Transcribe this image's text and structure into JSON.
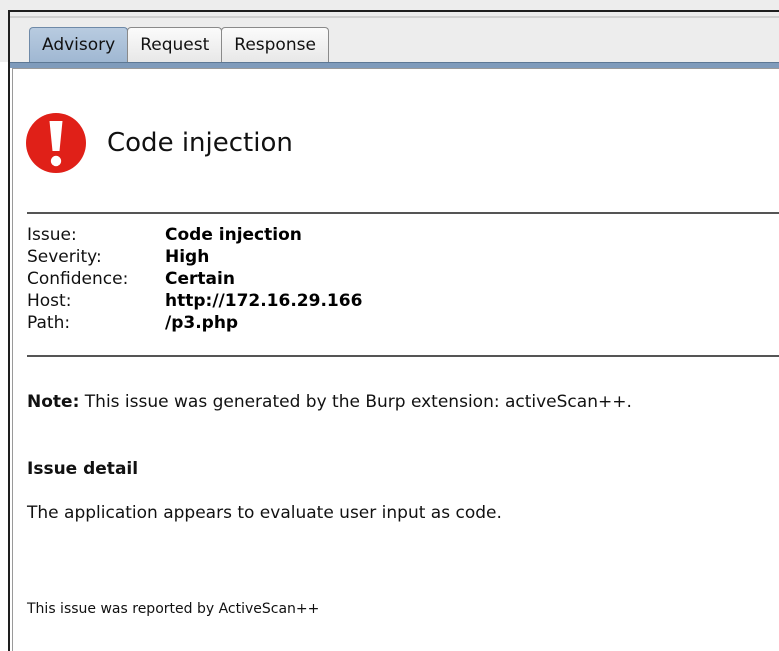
{
  "tabs": [
    {
      "label": "Advisory",
      "selected": true
    },
    {
      "label": "Request",
      "selected": false
    },
    {
      "label": "Response",
      "selected": false
    }
  ],
  "advisory": {
    "icon": "alert-exclamation-icon",
    "icon_color": "#e02018",
    "title": "Code injection",
    "fields": [
      {
        "label": "Issue:",
        "value": "Code injection"
      },
      {
        "label": "Severity:",
        "value": "High"
      },
      {
        "label": "Confidence:",
        "value": "Certain"
      },
      {
        "label": "Host:",
        "value": "http://172.16.29.166"
      },
      {
        "label": "Path:",
        "value": "/p3.php"
      }
    ],
    "note_label": "Note:",
    "note_text": " This issue was generated by the Burp extension: activeScan++.",
    "detail_heading": "Issue detail",
    "detail_text": "The application appears to evaluate user input as code.",
    "reported_by": "This issue was reported by ActiveScan++"
  }
}
